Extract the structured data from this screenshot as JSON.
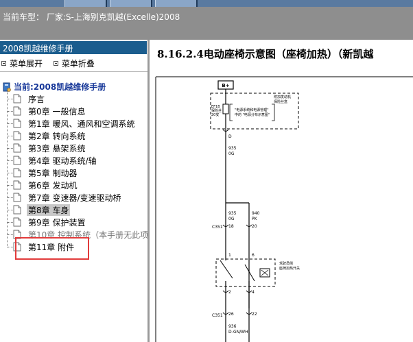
{
  "header": {
    "vehicle_label": "当前车型：  厂家:S-上海别克凯越(Excelle)2008"
  },
  "sidebar": {
    "manual_title": "2008凯越维修手册",
    "expand_label": "菜单展开",
    "collapse_label": "菜单折叠",
    "current_label": "当前:2008凯越维修手册",
    "items": [
      {
        "label": "序言"
      },
      {
        "label": "第0章 一般信息"
      },
      {
        "label": "第1章 暖风、通风和空调系统"
      },
      {
        "label": "第2章 转向系统"
      },
      {
        "label": "第3章 悬架系统"
      },
      {
        "label": "第4章 驱动系统/轴"
      },
      {
        "label": "第5章 制动器"
      },
      {
        "label": "第6章 发动机"
      },
      {
        "label": "第7章 变速器/变速驱动桥"
      },
      {
        "label": "第8章 车身"
      },
      {
        "label": "第9章 保护装置"
      },
      {
        "label": "第10章 控制系统（本手册无此项"
      },
      {
        "label": "第11章 附件"
      }
    ],
    "selected_index": 9
  },
  "document": {
    "heading": "8.16.2.4电动座椅示意图（座椅加热）（新凯越"
  },
  "diagram": {
    "supply_label": "B+",
    "fusebox_caption_1": "附加发动机",
    "fusebox_caption_2": "保险丝盒",
    "fuse_id": "EF1B",
    "fuse_type": "保险丝",
    "fuse_rating": "20安",
    "fuse_ref_1": "\"电源系统和电源管理\"",
    "fuse_ref_2": "中的 \"电源分布示意图\"",
    "pin_d": "D",
    "wire_935": "935",
    "wire_0g": "0G",
    "wire_935b": "935",
    "wire_0g_b": "0G",
    "wire_940": "940",
    "wire_pk": "PK",
    "conn_c351": "C351",
    "pin_18": "18",
    "pin_20": "20",
    "pin_1": "1",
    "pin_6": "6",
    "switch_caption_1": "驾驶员侧",
    "switch_caption_2": "座椅加热开关",
    "pin_2": "2",
    "pin_4": "4",
    "conn_c351b": "C351",
    "pin_26": "26",
    "pin_22": "22",
    "wire_936": "936",
    "wire_dgnwh": "D-GN/WH"
  },
  "colors": {
    "header_bg": "#8e8e8e",
    "title_bar_bg": "#1b5d8e",
    "highlight_box": "#e23b3b",
    "root_text": "#1a3a9a"
  }
}
